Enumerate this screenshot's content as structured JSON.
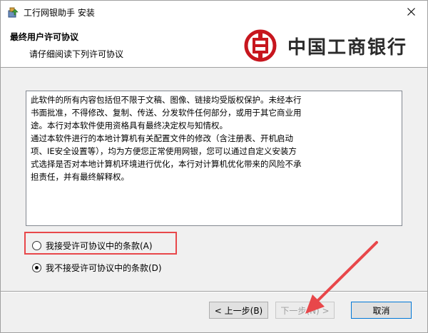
{
  "window": {
    "title": "工行网银助手 安装",
    "icon": "installer-package-icon"
  },
  "header": {
    "title": "最终用户许可协议",
    "subtitle": "请仔细阅读下列许可协议",
    "logo_text": "中国工商银行",
    "logo_icon": "icbc-logo-icon"
  },
  "license": {
    "lines": [
      "此软件的所有内容包括但不限于文稿、图像、链接均受版权保护。未经本行",
      "书面批准，不得修改、复制、传送、分发软件任何部分，或用于其它商业用",
      "途。本行对本软件使用资格具有最终决定权与知情权。",
      "通过本软件进行的本地计算机有关配置文件的修改（含注册表、开机启动",
      "项、IE安全设置等），均为方便您正常使用网银，您可以通过自定义安装方",
      "式选择是否对本地计算机环境进行优化，本行对计算机优化带来的风险不承",
      "担责任，并有最终解释权。"
    ]
  },
  "options": {
    "accept_label": "我接受许可协议中的条款(A)",
    "accept_checked": false,
    "decline_label": "我不接受许可协议中的条款(D)",
    "decline_checked": true
  },
  "buttons": {
    "back_label": "< 上一步(B)",
    "next_label": "下一步(N) >",
    "next_enabled": false,
    "cancel_label": "取消"
  },
  "colors": {
    "annotation_red": "#e8474a",
    "logo_red": "#c7161e"
  }
}
